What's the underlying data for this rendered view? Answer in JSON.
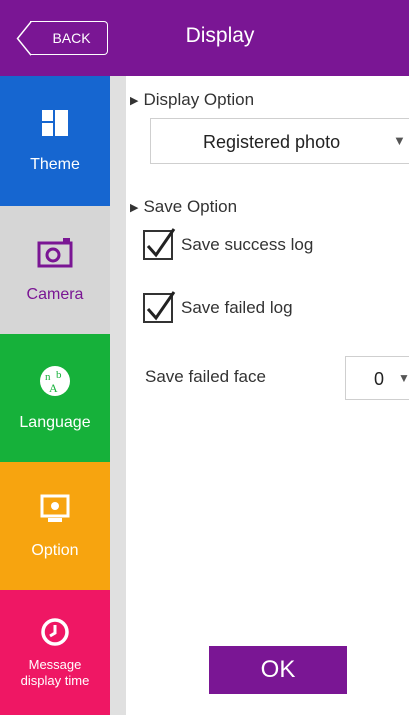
{
  "header": {
    "back_label": "BACK",
    "title": "Display"
  },
  "sidebar": {
    "items": [
      {
        "label": "Theme",
        "icon": "theme-icon",
        "color": "#1666d0"
      },
      {
        "label": "Camera",
        "icon": "camera-icon",
        "color": "#d6d6d6",
        "selected": true
      },
      {
        "label": "Language",
        "icon": "language-icon",
        "color": "#16b13a"
      },
      {
        "label": "Option",
        "icon": "option-icon",
        "color": "#f7a40f"
      },
      {
        "label": "Message display time",
        "icon": "clock-icon",
        "color": "#ef1764"
      }
    ]
  },
  "main": {
    "display_option_title": "Display Option",
    "display_option_value": "Registered photo",
    "save_option_title": "Save Option",
    "save_success_log": {
      "label": "Save success log",
      "checked": true
    },
    "save_failed_log": {
      "label": "Save failed log",
      "checked": true
    },
    "save_failed_face_label": "Save failed face",
    "save_failed_face_value": "0"
  },
  "ok_label": "OK",
  "colors": {
    "accent": "#7a1694"
  }
}
